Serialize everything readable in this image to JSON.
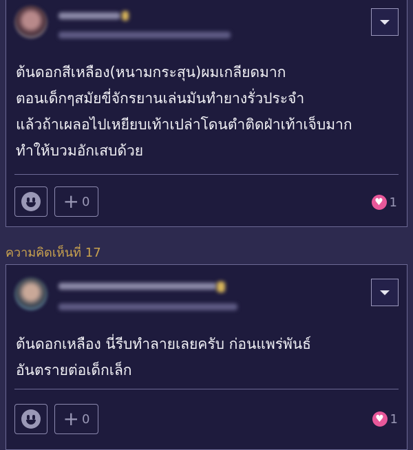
{
  "comments": [
    {
      "text": "ต้นดอกสีเหลือง(หนามกระสุน)ผมเกลียดมาก\nตอนเด็กๆสมัยขี่จักรยานเล่นมันทำยางรั่วประจำ\nแล้วถ้าเผลอไปเหยียบเท้าเปล่าโดนตำติดฝ่าเท้าเจ็บมาก\nทำให้บวมอักเสบด้วย",
      "plus_count": "0",
      "like_count": "1"
    },
    {
      "label": "ความคิดเห็นที่ 17",
      "text": "ต้นดอกเหลือง นี่รีบทำลายเลยครับ ก่อนแพร่พันธ์\nอันตรายต่อเด็กเล็ก",
      "plus_count": "0",
      "like_count": "1"
    }
  ],
  "icons": {
    "dropdown": "chevron-down-icon",
    "emoji": "smiley-icon",
    "plus": "plus-icon",
    "heart": "heart-icon"
  },
  "colors": {
    "background": "#2d2a4f",
    "card": "#1e1b3d",
    "border": "#6d6a96",
    "label": "#c9a24f",
    "heart": "#e8589a"
  }
}
